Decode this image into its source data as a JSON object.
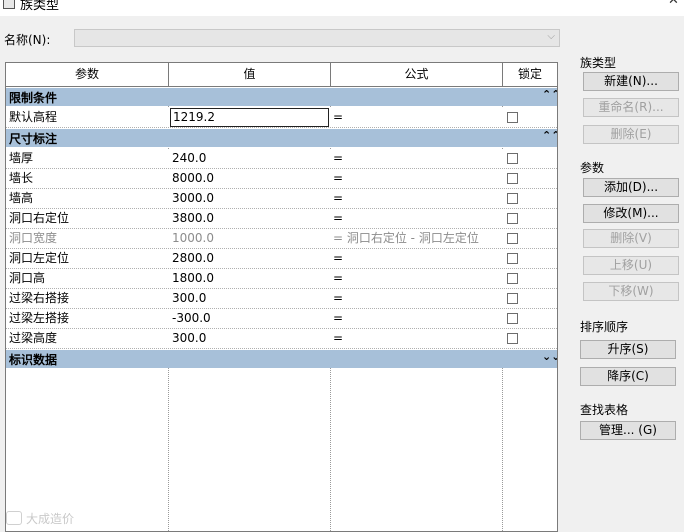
{
  "window": {
    "title": "族类型"
  },
  "name_field": {
    "label": "名称(N):",
    "value": ""
  },
  "grid": {
    "headers": {
      "param": "参数",
      "value": "值",
      "formula": "公式",
      "lock": "锁定"
    },
    "groups": [
      {
        "label": "限制条件",
        "chevron": "⌃⌃",
        "rows": [
          {
            "name": "默认高程",
            "value": "1219.2",
            "formula": "=",
            "editing": true,
            "disabled": false
          }
        ]
      },
      {
        "label": "尺寸标注",
        "chevron": "⌃⌃",
        "rows": [
          {
            "name": "墙厚",
            "value": "240.0",
            "formula": "=",
            "disabled": false
          },
          {
            "name": "墙长",
            "value": "8000.0",
            "formula": "=",
            "disabled": false
          },
          {
            "name": "墙高",
            "value": "3000.0",
            "formula": "=",
            "disabled": false
          },
          {
            "name": "洞口右定位",
            "value": "3800.0",
            "formula": "=",
            "disabled": false
          },
          {
            "name": "洞口宽度",
            "value": "1000.0",
            "formula": "= 洞口右定位 - 洞口左定位",
            "disabled": true
          },
          {
            "name": "洞口左定位",
            "value": "2800.0",
            "formula": "=",
            "disabled": false
          },
          {
            "name": "洞口高",
            "value": "1800.0",
            "formula": "=",
            "disabled": false
          },
          {
            "name": "过梁右搭接",
            "value": "300.0",
            "formula": "=",
            "disabled": false
          },
          {
            "name": "过梁左搭接",
            "value": "-300.0",
            "formula": "=",
            "disabled": false
          },
          {
            "name": "过梁高度",
            "value": "300.0",
            "formula": "=",
            "disabled": false
          }
        ]
      },
      {
        "label": "标识数据",
        "chevron": "⌄⌄",
        "rows": []
      }
    ]
  },
  "side": {
    "family_types": {
      "label": "族类型",
      "new": "新建(N)...",
      "rename": "重命名(R)...",
      "delete": "删除(E)"
    },
    "params": {
      "label": "参数",
      "add": "添加(D)...",
      "modify": "修改(M)...",
      "delete": "删除(V)",
      "up": "上移(U)",
      "down": "下移(W)"
    },
    "sort": {
      "label": "排序顺序",
      "asc": "升序(S)",
      "desc": "降序(C)"
    },
    "lookup": {
      "label": "查找表格",
      "manage": "管理... (G)"
    }
  },
  "watermark": "大成造价"
}
